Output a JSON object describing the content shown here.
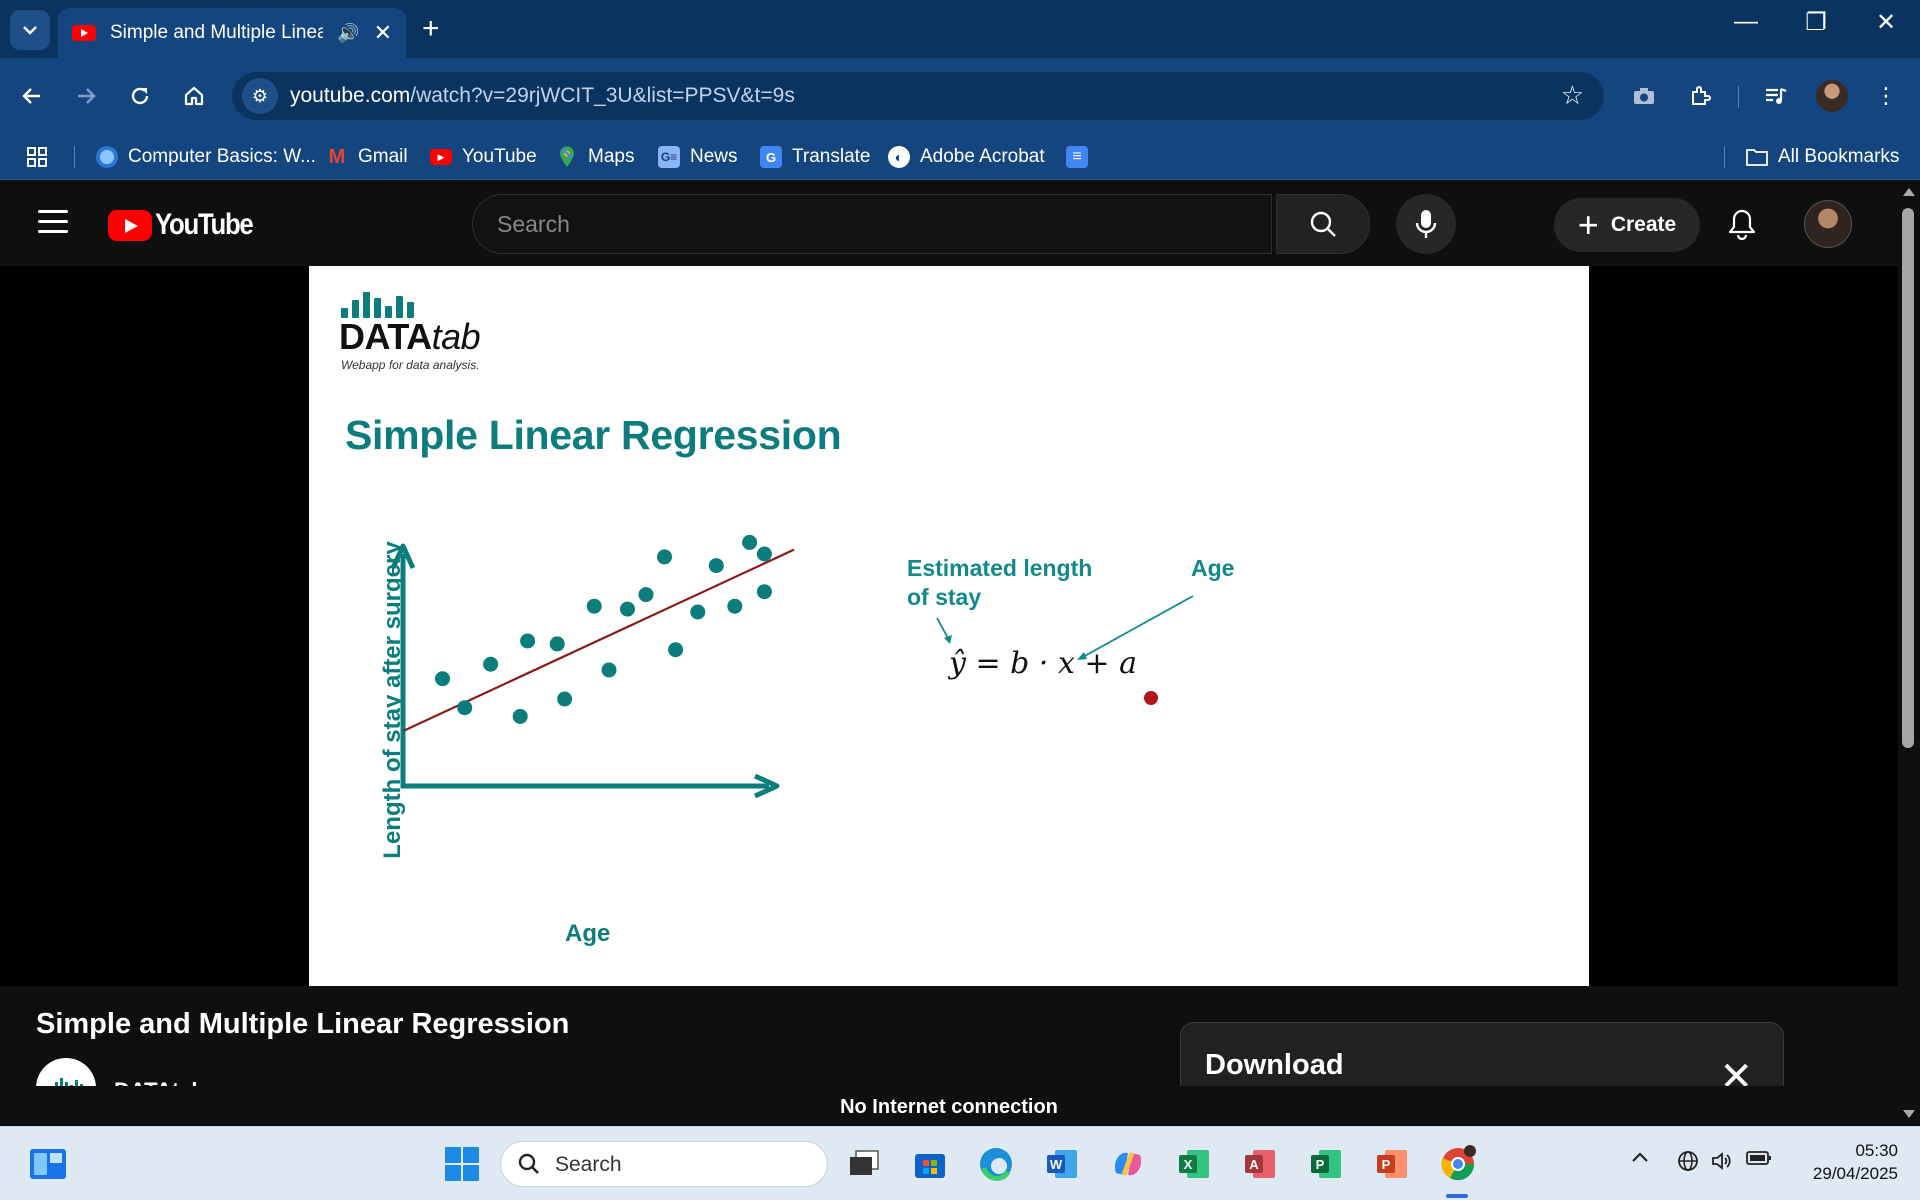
{
  "browser": {
    "tab": {
      "title": "Simple and Multiple Linear Regression"
    },
    "url": {
      "host": "youtube.com",
      "path": "/watch?v=29rjWCIT_3U&list=PPSV&t=9s"
    },
    "bookmarks": [
      {
        "label": "Computer Basics: W...",
        "icon": "globe-cloud-icon"
      },
      {
        "label": "Gmail",
        "icon": "gmail-icon"
      },
      {
        "label": "YouTube",
        "icon": "youtube-icon"
      },
      {
        "label": "Maps",
        "icon": "maps-icon"
      },
      {
        "label": "News",
        "icon": "news-icon"
      },
      {
        "label": "Translate",
        "icon": "translate-icon"
      },
      {
        "label": "Adobe Acrobat",
        "icon": "acrobat-icon"
      }
    ],
    "all_bookmarks": "All Bookmarks"
  },
  "youtube": {
    "logo_text": "YouTube",
    "search_placeholder": "Search",
    "create_label": "Create"
  },
  "slide": {
    "brand_bold": "DATA",
    "brand_italic": "tab",
    "tagline": "Webapp for data analysis.",
    "title": "Simple Linear Regression",
    "annotation_y_line1": "Estimated length",
    "annotation_y_line2": "of stay",
    "annotation_x": "Age",
    "equation": "ŷ = b · x + a",
    "x_axis_label": "Age",
    "y_axis_label": "Length of stay after surgery"
  },
  "chart_data": {
    "type": "scatter",
    "xlabel": "Age",
    "ylabel": "Length of stay after surgery",
    "xlim": [
      0,
      100
    ],
    "ylim": [
      0,
      100
    ],
    "points": [
      [
        5,
        37
      ],
      [
        11,
        27
      ],
      [
        18,
        42
      ],
      [
        26,
        24
      ],
      [
        28,
        50
      ],
      [
        36,
        49
      ],
      [
        38,
        30
      ],
      [
        46,
        62
      ],
      [
        50,
        40
      ],
      [
        55,
        61
      ],
      [
        60,
        66
      ],
      [
        65,
        79
      ],
      [
        68,
        47
      ],
      [
        74,
        60
      ],
      [
        79,
        76
      ],
      [
        84,
        62
      ],
      [
        88,
        84
      ],
      [
        92,
        80
      ],
      [
        92,
        67
      ]
    ],
    "regression_line": {
      "x": [
        0,
        100
      ],
      "y": [
        24.5,
        81.5
      ],
      "color": "#8b1a1a"
    },
    "marker_color": "#0d7c7c"
  },
  "video": {
    "title": "Simple and Multiple Linear Regression",
    "channel": "DATAtab"
  },
  "download_panel": {
    "title": "Download"
  },
  "status": {
    "offline": "No Internet connection"
  },
  "taskbar": {
    "search_placeholder": "Search",
    "time": "05:30",
    "date": "29/04/2025"
  }
}
